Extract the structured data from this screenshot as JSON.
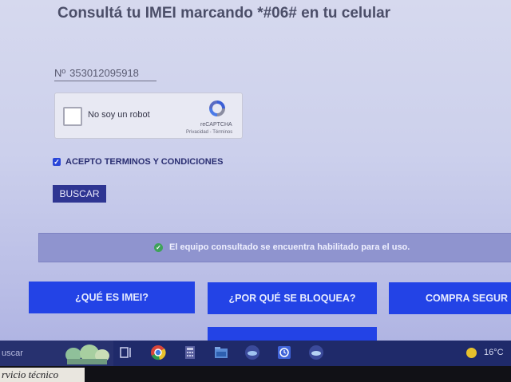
{
  "heading": "Consultá tu IMEI marcando *#06# en tu celular",
  "imei": {
    "prefix": "Nº",
    "value": "353012095918"
  },
  "captcha": {
    "label": "No soy un robot",
    "brand": "reCAPTCHA",
    "links": "Privacidad - Términos",
    "checked": false
  },
  "terms": {
    "label": "ACEPTO TERMINOS Y CONDICIONES",
    "checked": true
  },
  "search_button": "BUSCAR",
  "status": {
    "message": "El equipo consultado se encuentra habilitado para el uso.",
    "icon": "check-circle-icon"
  },
  "cards": [
    {
      "label": "¿QUÉ ES IMEI?"
    },
    {
      "label": "¿POR QUÉ SE BLOQUEA?"
    },
    {
      "label": "COMPRA SEGUR"
    }
  ],
  "taskbar": {
    "search_text": "uscar",
    "temperature": "16°C",
    "apps": [
      "task-view-icon",
      "chrome-icon",
      "calculator-icon",
      "file-explorer-icon",
      "network-app-icon",
      "clock-app-icon",
      "cloud-app-icon"
    ]
  },
  "sticker": "rvicio técnico",
  "colors": {
    "accent": "#2343e6",
    "button": "#2e3592",
    "status_bg": "#8f94cf",
    "success": "#3fa25a"
  }
}
